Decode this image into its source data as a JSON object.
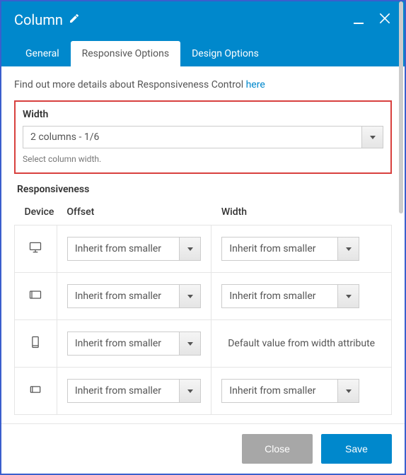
{
  "header": {
    "title": "Column"
  },
  "tabs": {
    "general": "General",
    "responsive": "Responsive Options",
    "design": "Design Options"
  },
  "intro": {
    "text": "Find out more details about Responsiveness Control ",
    "link": "here"
  },
  "width": {
    "label": "Width",
    "value": "2 columns - 1/6",
    "help": "Select column width."
  },
  "responsiveness": {
    "title": "Responsiveness",
    "cols": {
      "device": "Device",
      "offset": "Offset",
      "width": "Width"
    },
    "inherit": "Inherit from smaller",
    "default_width": "Default value from width attribute"
  },
  "footer": {
    "close": "Close",
    "save": "Save"
  }
}
